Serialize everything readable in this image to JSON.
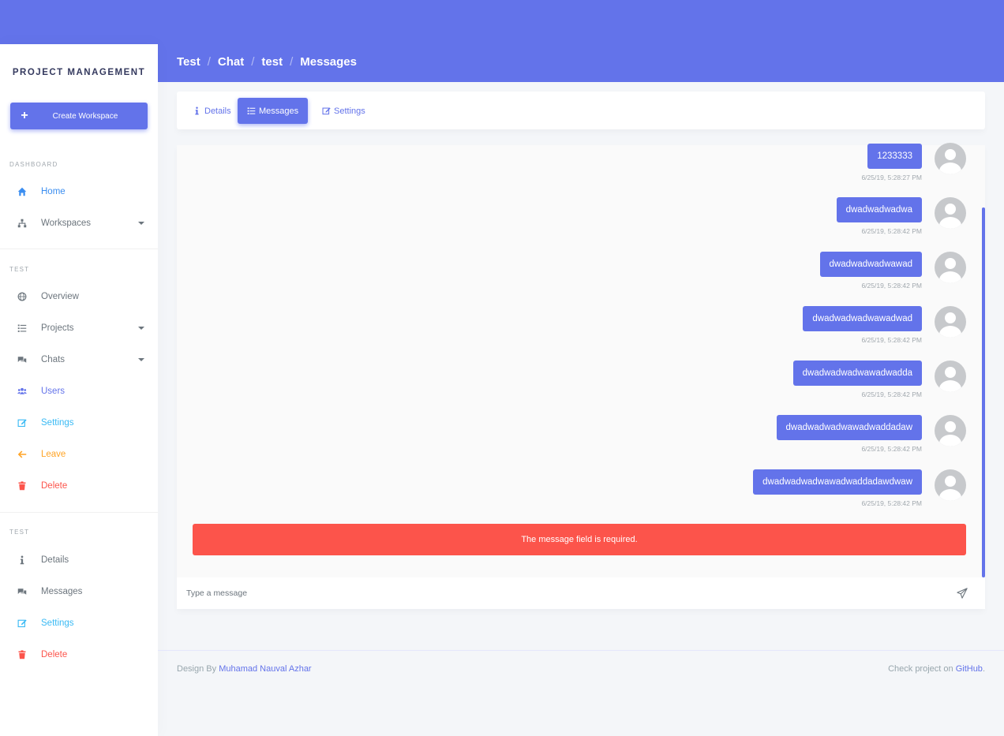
{
  "sidebar": {
    "brand": "PROJECT MANAGEMENT",
    "create_button": "Create Workspace",
    "sections": {
      "dashboard": "DASHBOARD",
      "workspace": "TEST",
      "chat": "TEST"
    },
    "dashboard_items": [
      {
        "label": "Home",
        "icon": "home-icon"
      },
      {
        "label": "Workspaces",
        "icon": "sitemap-icon"
      }
    ],
    "workspace_items": [
      {
        "label": "Overview",
        "icon": "globe-icon"
      },
      {
        "label": "Projects",
        "icon": "list-icon"
      },
      {
        "label": "Chats",
        "icon": "comments-icon"
      },
      {
        "label": "Users",
        "icon": "users-icon"
      },
      {
        "label": "Settings",
        "icon": "edit-icon"
      },
      {
        "label": "Leave",
        "icon": "arrow-left-icon"
      },
      {
        "label": "Delete",
        "icon": "trash-icon"
      }
    ],
    "chat_items": [
      {
        "label": "Details",
        "icon": "info-icon"
      },
      {
        "label": "Messages",
        "icon": "comments-icon"
      },
      {
        "label": "Settings",
        "icon": "edit-icon"
      },
      {
        "label": "Delete",
        "icon": "trash-icon"
      }
    ]
  },
  "breadcrumb": [
    "Test",
    "Chat",
    "test",
    "Messages"
  ],
  "tabs": [
    {
      "label": "Details",
      "icon": "info-icon"
    },
    {
      "label": "Messages",
      "icon": "list-icon",
      "active": true
    },
    {
      "label": "Settings",
      "icon": "edit-icon"
    }
  ],
  "messages": [
    {
      "text": "1233333",
      "time": "6/25/19, 5:28:27 PM"
    },
    {
      "text": "dwadwadwadwa",
      "time": "6/25/19, 5:28:42 PM"
    },
    {
      "text": "dwadwadwadwawad",
      "time": "6/25/19, 5:28:42 PM"
    },
    {
      "text": "dwadwadwadwawadwad",
      "time": "6/25/19, 5:28:42 PM"
    },
    {
      "text": "dwadwadwadwawadwadda",
      "time": "6/25/19, 5:28:42 PM"
    },
    {
      "text": "dwadwadwadwawadwaddadaw",
      "time": "6/25/19, 5:28:42 PM"
    },
    {
      "text": "dwadwadwadwawadwaddadawdwaw",
      "time": "6/25/19, 5:28:42 PM"
    }
  ],
  "alert": "The message field is required.",
  "composer": {
    "placeholder": "Type a message",
    "send_icon": "paper-plane-icon"
  },
  "footer": {
    "left_prefix": "Design By ",
    "left_link": "Muhamad Nauval Azhar",
    "right_prefix": "Check project on ",
    "right_link": "GitHub",
    "right_suffix": "."
  },
  "colors": {
    "primary": "#6373ea",
    "danger": "#fc544b",
    "warning": "#ffa426",
    "info": "#3abaf4"
  }
}
